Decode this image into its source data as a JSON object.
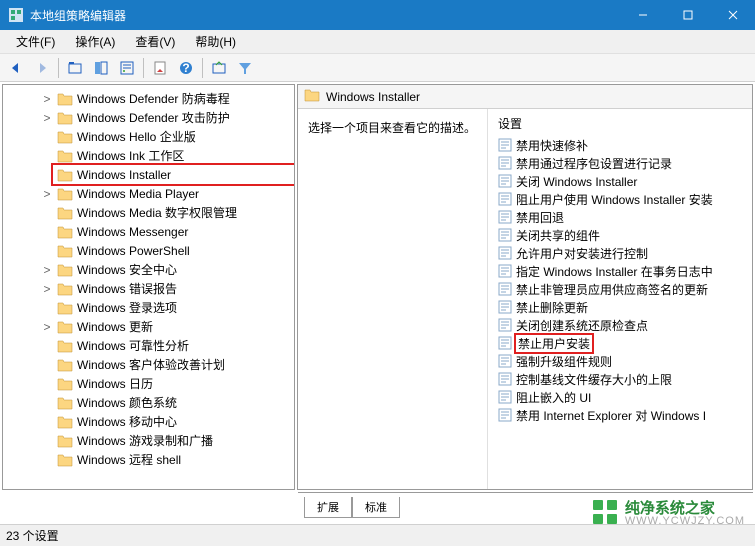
{
  "window": {
    "title": "本地组策略编辑器"
  },
  "menus": {
    "file": "文件(F)",
    "action": "操作(A)",
    "view": "查看(V)",
    "help": "帮助(H)"
  },
  "tree": {
    "items": [
      {
        "label": "Windows Defender 防病毒程",
        "expander": ">"
      },
      {
        "label": "Windows Defender 攻击防护",
        "expander": ">"
      },
      {
        "label": "Windows Hello 企业版",
        "expander": ""
      },
      {
        "label": "Windows Ink 工作区",
        "expander": ""
      },
      {
        "label": "Windows Installer",
        "expander": "",
        "highlighted": true
      },
      {
        "label": "Windows Media Player",
        "expander": ">"
      },
      {
        "label": "Windows Media 数字权限管理",
        "expander": ""
      },
      {
        "label": "Windows Messenger",
        "expander": ""
      },
      {
        "label": "Windows PowerShell",
        "expander": ""
      },
      {
        "label": "Windows 安全中心",
        "expander": ">"
      },
      {
        "label": "Windows 错误报告",
        "expander": ">"
      },
      {
        "label": "Windows 登录选项",
        "expander": ""
      },
      {
        "label": "Windows 更新",
        "expander": ">"
      },
      {
        "label": "Windows 可靠性分析",
        "expander": ""
      },
      {
        "label": "Windows 客户体验改善计划",
        "expander": ""
      },
      {
        "label": "Windows 日历",
        "expander": ""
      },
      {
        "label": "Windows 颜色系统",
        "expander": ""
      },
      {
        "label": "Windows 移动中心",
        "expander": ""
      },
      {
        "label": "Windows 游戏录制和广播",
        "expander": ""
      },
      {
        "label": "Windows 远程 shell",
        "expander": ""
      }
    ]
  },
  "right": {
    "header": "Windows Installer",
    "description": "选择一个项目来查看它的描述。",
    "settings_header": "设置",
    "items": [
      {
        "label": "禁用快速修补"
      },
      {
        "label": "禁用通过程序包设置进行记录"
      },
      {
        "label": "关闭 Windows Installer"
      },
      {
        "label": "阻止用户使用 Windows Installer 安装"
      },
      {
        "label": "禁用回退"
      },
      {
        "label": "关闭共享的组件"
      },
      {
        "label": "允许用户对安装进行控制"
      },
      {
        "label": "指定 Windows Installer 在事务日志中"
      },
      {
        "label": "禁止非管理员应用供应商签名的更新"
      },
      {
        "label": "禁止删除更新"
      },
      {
        "label": "关闭创建系统还原检查点"
      },
      {
        "label": "禁止用户安装",
        "highlighted": true
      },
      {
        "label": "强制升级组件规则"
      },
      {
        "label": "控制基线文件缓存大小的上限"
      },
      {
        "label": "阻止嵌入的 UI"
      },
      {
        "label": "禁用 Internet Explorer 对 Windows I"
      }
    ]
  },
  "tabs": {
    "extended": "扩展",
    "standard": "标准"
  },
  "status": "23 个设置",
  "watermark": {
    "name": "纯净系统之家",
    "url": "WWW.YCWJZY.COM"
  }
}
